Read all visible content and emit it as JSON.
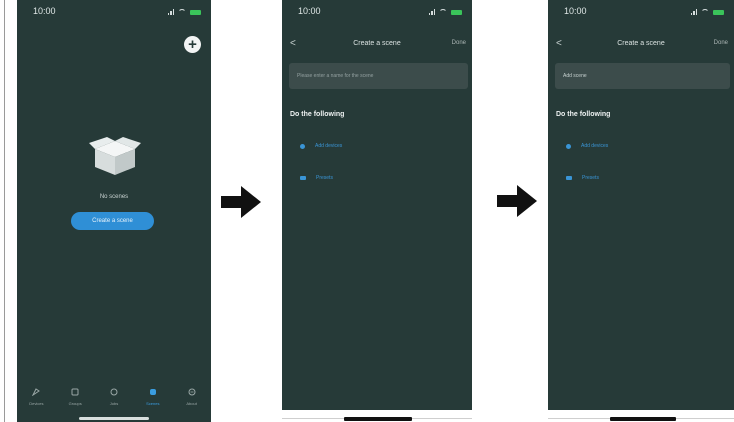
{
  "colors": {
    "screen_bg": "#263a38",
    "accent": "#2f8fd6",
    "battery": "#3ac45a",
    "field_bg": "#3c4c4b"
  },
  "screen1": {
    "time": "10:00",
    "add_icon": "plus-circle-icon",
    "empty_icon": "empty-box-icon",
    "empty_text": "No scenes",
    "create_button": "Create a scene",
    "tabs": [
      {
        "label": "Devices",
        "icon": "devices-icon",
        "active": false
      },
      {
        "label": "Groups",
        "icon": "groups-icon",
        "active": false
      },
      {
        "label": "Jobs",
        "icon": "jobs-icon",
        "active": false
      },
      {
        "label": "Scenes",
        "icon": "scenes-icon",
        "active": true
      },
      {
        "label": "About",
        "icon": "about-icon",
        "active": false
      }
    ]
  },
  "screen2": {
    "time": "10:00",
    "title": "Create a scene",
    "done": "Done",
    "name_placeholder": "Please enter a name for the scene",
    "section": "Do the following",
    "options": [
      "Add devices",
      "Presets"
    ]
  },
  "screen3": {
    "time": "10:00",
    "title": "Create a scene",
    "done": "Done",
    "name_value": "Add scene",
    "section": "Do the following",
    "options": [
      "Add devices",
      "Presets"
    ]
  },
  "arrows": [
    "right-arrow-icon",
    "right-arrow-icon"
  ]
}
